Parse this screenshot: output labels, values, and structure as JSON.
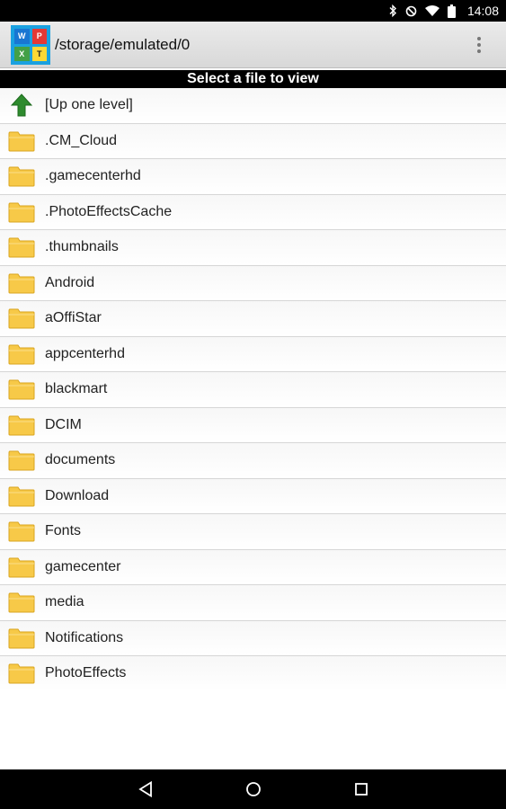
{
  "status_bar": {
    "time": "14:08",
    "icons": [
      "bluetooth-icon",
      "do-not-disturb-icon",
      "wifi-icon",
      "battery-icon"
    ]
  },
  "app_bar": {
    "logo_letters": [
      "W",
      "P",
      "X",
      "T"
    ],
    "path": "/storage/emulated/0",
    "menu_icon": "overflow-menu-icon"
  },
  "header": {
    "title": "Select a file to view"
  },
  "file_list": {
    "up_item": {
      "label": "[Up one level]",
      "icon": "up-arrow-icon"
    },
    "folders": [
      ".CM_Cloud",
      ".gamecenterhd",
      ".PhotoEffectsCache",
      ".thumbnails",
      "Android",
      "aOffiStar",
      "appcenterhd",
      "blackmart",
      "DCIM",
      "documents",
      "Download",
      "Fonts",
      "gamecenter",
      "media",
      "Notifications",
      "PhotoEffects"
    ]
  },
  "nav_bar": {
    "buttons": [
      "back-icon",
      "home-icon",
      "recents-icon"
    ]
  },
  "colors": {
    "folder": "#f7c948",
    "up_arrow": "#2e8b2e",
    "logo_bg": "#1aa1e0"
  }
}
